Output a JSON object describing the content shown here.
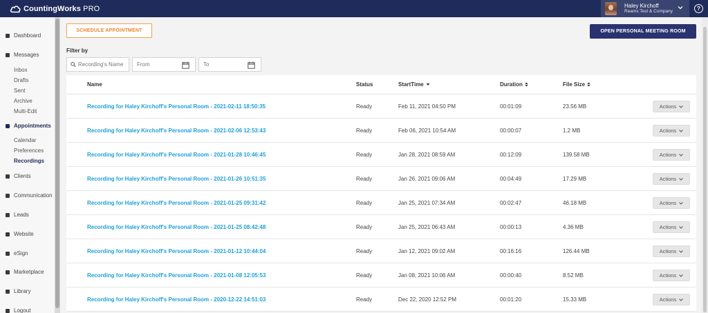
{
  "app": {
    "logo_text": "CountingWorks",
    "logo_suffix": "PRO"
  },
  "user": {
    "name": "Haley Kirchoff",
    "company": "Reams Test & Company"
  },
  "help": {
    "label": "?"
  },
  "sidebar": {
    "items": [
      {
        "label": "Dashboard",
        "icon": "dashboard-icon"
      },
      {
        "label": "Messages",
        "icon": "messages-icon"
      },
      {
        "label": "Appointments",
        "icon": "appointments-icon"
      },
      {
        "label": "Clients",
        "icon": "clients-icon"
      },
      {
        "label": "Communication",
        "icon": "communication-icon"
      },
      {
        "label": "Leads",
        "icon": "leads-icon"
      },
      {
        "label": "Website",
        "icon": "website-icon"
      },
      {
        "label": "eSign",
        "icon": "esign-icon"
      },
      {
        "label": "Marketplace",
        "icon": "marketplace-icon"
      },
      {
        "label": "Library",
        "icon": "library-icon"
      },
      {
        "label": "Logout",
        "icon": "logout-icon"
      }
    ],
    "messages_sub": [
      "Inbox",
      "Drafts",
      "Sent",
      "Archive",
      "Multi-Edit"
    ],
    "appointments_sub": [
      "Calendar",
      "Preferences",
      "Recordings"
    ],
    "active_item": "Appointments",
    "active_sub": "Recordings"
  },
  "toolbar": {
    "schedule_label": "SCHEDULE APPOINTMENT",
    "open_room_label": "OPEN PERSONAL MEETING ROOM"
  },
  "filter": {
    "label": "Filter by",
    "search_placeholder": "Recording's Name",
    "from_placeholder": "From",
    "to_placeholder": "To"
  },
  "table": {
    "columns": {
      "name": "Name",
      "status": "Status",
      "start": "StartTime",
      "duration": "Duration",
      "size": "File Size"
    },
    "actions_label": "Actions",
    "rows": [
      {
        "name": "Recording for Haley Kirchoff's Personal Room - 2021-02-11 18:50:35",
        "status": "Ready",
        "start": "Feb 11, 2021 04:50 PM",
        "duration": "00:01:09",
        "size": "23.56 MB"
      },
      {
        "name": "Recording for Haley Kirchoff's Personal Room - 2021-02-06 12:53:43",
        "status": "Ready",
        "start": "Feb 06, 2021 10:54 AM",
        "duration": "00:00:07",
        "size": "1.2 MB"
      },
      {
        "name": "Recording for Haley Kirchoff's Personal Room - 2021-01-28 10:46:45",
        "status": "Ready",
        "start": "Jan 28, 2021 08:59 AM",
        "duration": "00:12:09",
        "size": "139.58 MB"
      },
      {
        "name": "Recording for Haley Kirchoff's Personal Room - 2021-01-26 10:51:35",
        "status": "Ready",
        "start": "Jan 26, 2021 09:06 AM",
        "duration": "00:04:49",
        "size": "17.29 MB"
      },
      {
        "name": "Recording for Haley Kirchoff's Personal Room - 2021-01-25 09:31:42",
        "status": "Ready",
        "start": "Jan 25, 2021 07:34 AM",
        "duration": "00:02:47",
        "size": "46.18 MB"
      },
      {
        "name": "Recording for Haley Kirchoff's Personal Room - 2021-01-25 08:42:48",
        "status": "Ready",
        "start": "Jan 25, 2021 06:43 AM",
        "duration": "00:00:13",
        "size": "4.36 MB"
      },
      {
        "name": "Recording for Haley Kirchoff's Personal Room - 2021-01-12 10:44:04",
        "status": "Ready",
        "start": "Jan 12, 2021 09:02 AM",
        "duration": "00:16:16",
        "size": "126.44 MB"
      },
      {
        "name": "Recording for Haley Kirchoff's Personal Room - 2021-01-08 12:05:53",
        "status": "Ready",
        "start": "Jan 08, 2021 10:06 AM",
        "duration": "00:00:40",
        "size": "8.52 MB"
      },
      {
        "name": "Recording for Haley Kirchoff's Personal Room - 2020-12-22 14:51:03",
        "status": "Ready",
        "start": "Dec 22, 2020 12:52 PM",
        "duration": "00:01:20",
        "size": "15.33 MB"
      }
    ]
  },
  "colors": {
    "topbar": "#1f2b5a",
    "link": "#1ea0d8",
    "accent_orange": "#e8862a",
    "primary_button": "#2a3270"
  }
}
